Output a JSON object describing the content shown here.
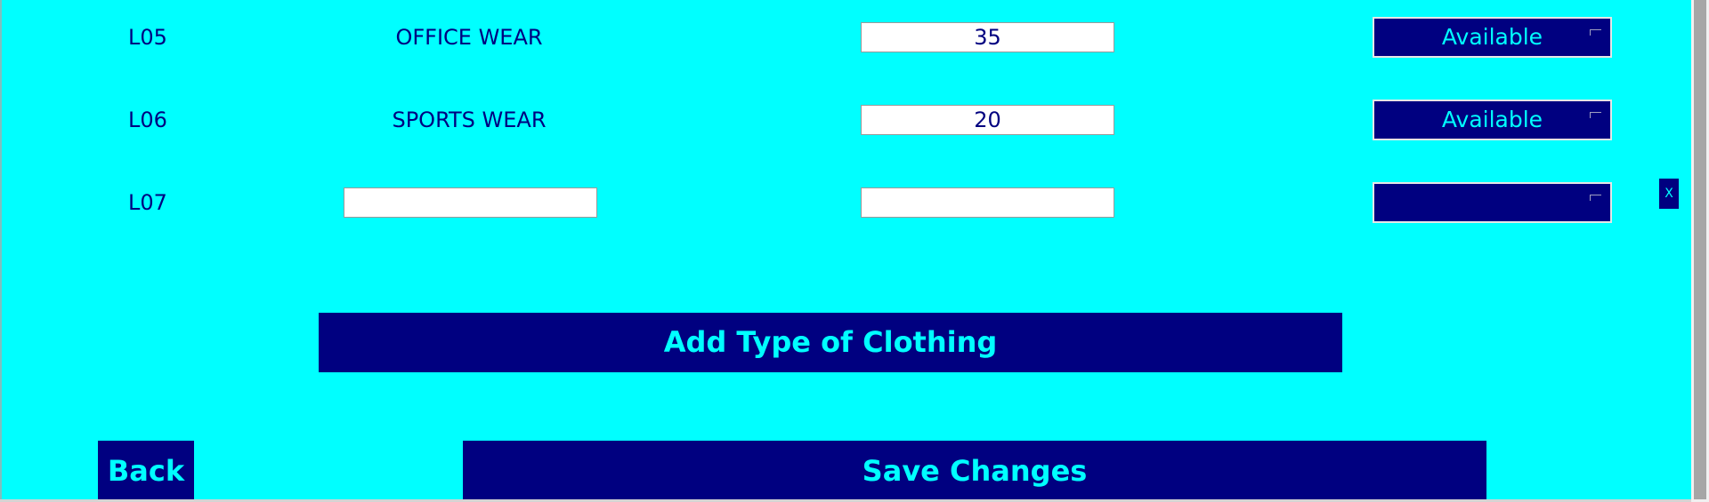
{
  "rows": [
    {
      "code": "L05",
      "name": "OFFICE WEAR",
      "quantity": "35",
      "status": "Available"
    },
    {
      "code": "L06",
      "name": "SPORTS WEAR",
      "quantity": "20",
      "status": "Available"
    },
    {
      "code": "L07",
      "name": "",
      "quantity": "",
      "status": "",
      "remove_label": "X"
    }
  ],
  "buttons": {
    "add_type": "Add Type of Clothing",
    "back": "Back",
    "save": "Save Changes"
  }
}
